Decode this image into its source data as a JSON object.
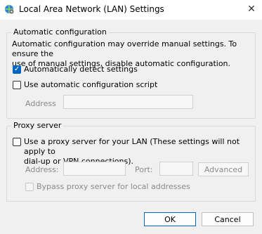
{
  "window": {
    "title": "Local Area Network (LAN) Settings",
    "icon": "network-settings-icon",
    "close_glyph": "✕"
  },
  "auto_config": {
    "group_title": "Automatic configuration",
    "description_line1": "Automatic configuration may override manual settings.  To ensure the",
    "description_line2": "use of manual settings, disable automatic configuration.",
    "auto_detect": {
      "label": "Automatically detect settings",
      "checked": true
    },
    "auto_script": {
      "label": "Use automatic configuration script",
      "checked": false
    },
    "address_label": "Address",
    "address_value": ""
  },
  "proxy": {
    "group_title": "Proxy server",
    "use_proxy_line1": "Use a proxy server for your LAN (These settings will not apply to",
    "use_proxy_line2": "dial-up or VPN connections).",
    "use_proxy_checked": false,
    "address_label": "Address:",
    "address_value": "",
    "port_label": "Port:",
    "port_value": "",
    "advanced_label": "Advanced",
    "bypass_label": "Bypass proxy server for local addresses",
    "bypass_checked": false
  },
  "buttons": {
    "ok": "OK",
    "cancel": "Cancel"
  },
  "colors": {
    "accent": "#0067c0",
    "disabled_text": "#8a8a8a",
    "background": "#f0f0f0"
  }
}
